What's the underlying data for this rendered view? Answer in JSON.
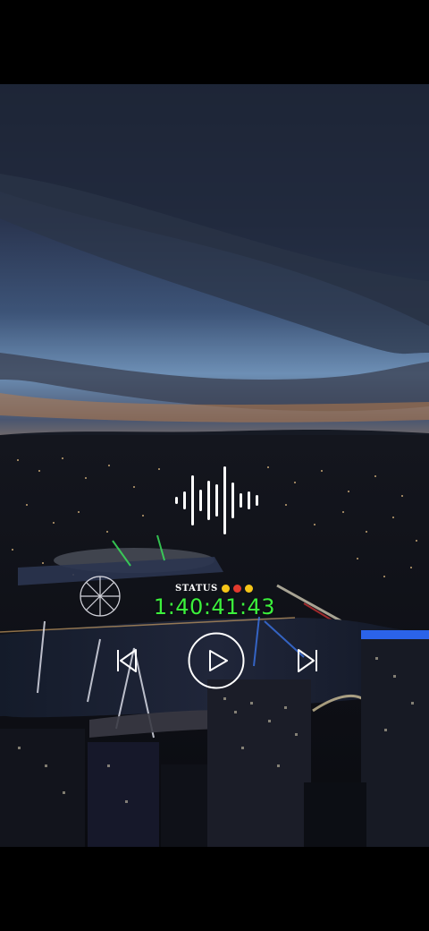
{
  "status": {
    "label": "STATUS",
    "dots": [
      "#f5c518",
      "#e23a2e",
      "#f5c518"
    ]
  },
  "timer": {
    "value": "1:40:41:43",
    "color": "#3cf03c"
  },
  "controls": {
    "previous_icon": "skip-previous-icon",
    "play_icon": "play-icon",
    "next_icon": "skip-next-icon"
  },
  "waveform": {
    "icon": "audio-waveform-icon",
    "color": "#ffffff"
  }
}
